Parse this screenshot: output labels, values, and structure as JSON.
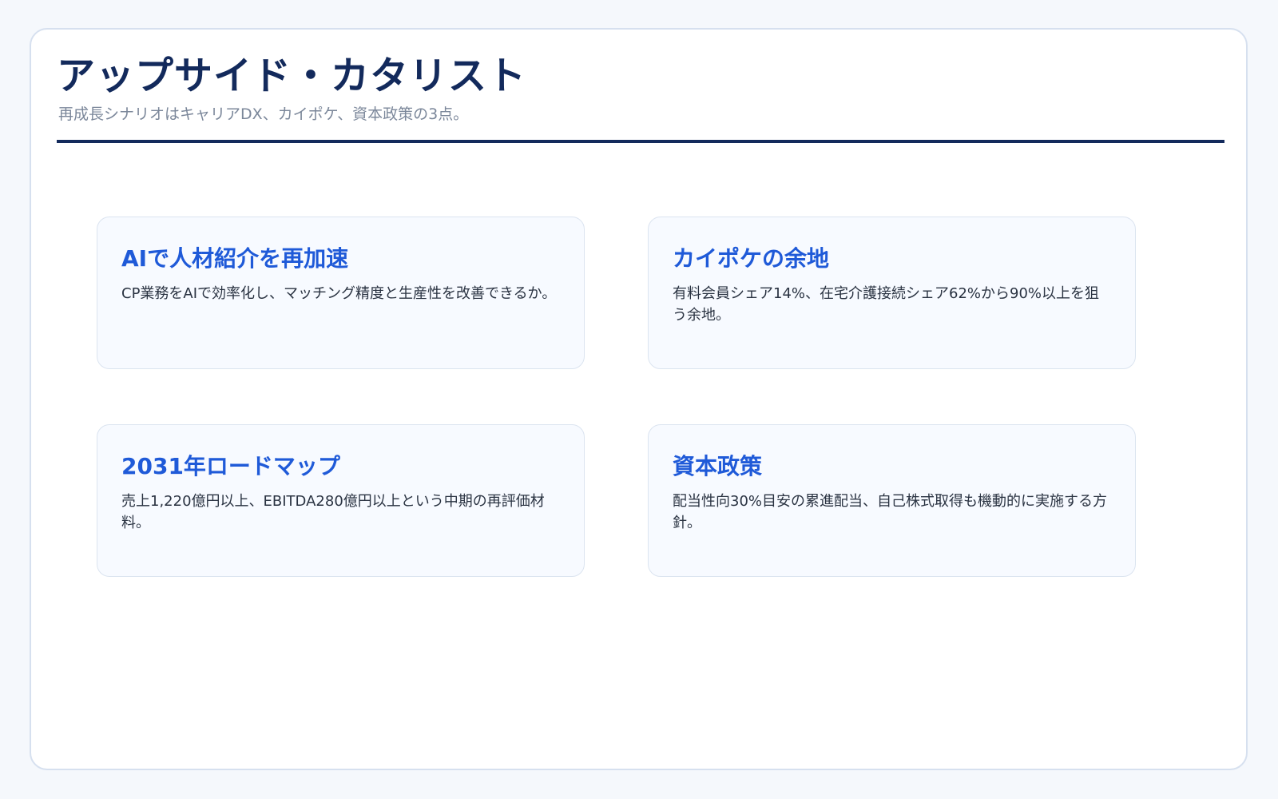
{
  "header": {
    "title": "アップサイド・カタリスト",
    "subtitle": "再成長シナリオはキャリアDX、カイポケ、資本政策の3点。"
  },
  "cards": [
    {
      "title": "AIで人材紹介を再加速",
      "body": "CP業務をAIで効率化し、マッチング精度と生産性を改善できるか。"
    },
    {
      "title": "カイポケの余地",
      "body": "有料会員シェア14%、在宅介護接続シェア62%から90%以上を狙う余地。"
    },
    {
      "title": "2031年ロードマップ",
      "body": "売上1,220億円以上、EBITDA280億円以上という中期の再評価材料。"
    },
    {
      "title": "資本政策",
      "body": "配当性向30%目安の累進配当、自己株式取得も機動的に実施する方針。"
    }
  ],
  "colors": {
    "navy": "#132a5c",
    "accent_blue": "#1f5ad8",
    "card_bg": "#f7faff",
    "page_bg": "#f5f8fc"
  }
}
